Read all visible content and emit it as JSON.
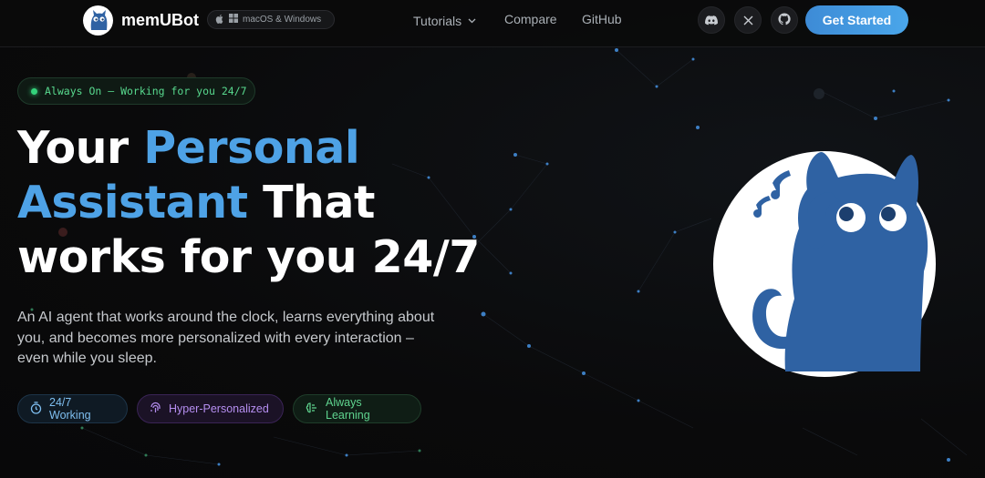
{
  "nav": {
    "brand": "memUBot",
    "platform_label": "macOS & Windows",
    "links": [
      {
        "label": "Tutorials",
        "has_dropdown": true
      },
      {
        "label": "Compare"
      },
      {
        "label": "GitHub"
      }
    ],
    "social_icons": [
      "discord-icon",
      "x-icon",
      "github-icon"
    ],
    "cta_label": "Get Started"
  },
  "hero": {
    "status_text": "Always On — Working for you 24/7",
    "headline": {
      "line1_plain": "Your ",
      "line1_accent": "Personal",
      "line2_accent": "Assistant",
      "line2_plain": " That",
      "line3_plain": "works for you 24/7"
    },
    "subtitle": "An AI agent that works around the clock, learns everything about you, and becomes more personalized with every interaction – even while you sleep.",
    "features": [
      {
        "label": "24/7 Working",
        "icon": "stopwatch-icon"
      },
      {
        "label": "Hyper-Personalized",
        "icon": "fingerprint-icon"
      },
      {
        "label": "Always Learning",
        "icon": "brain-icon"
      }
    ]
  },
  "colors": {
    "accent": "#4ea2e6",
    "cta": "#3d8bd6",
    "status_green": "#34d27b",
    "mascot_blue": "#2f62a3",
    "background": "#0b0b0c"
  }
}
